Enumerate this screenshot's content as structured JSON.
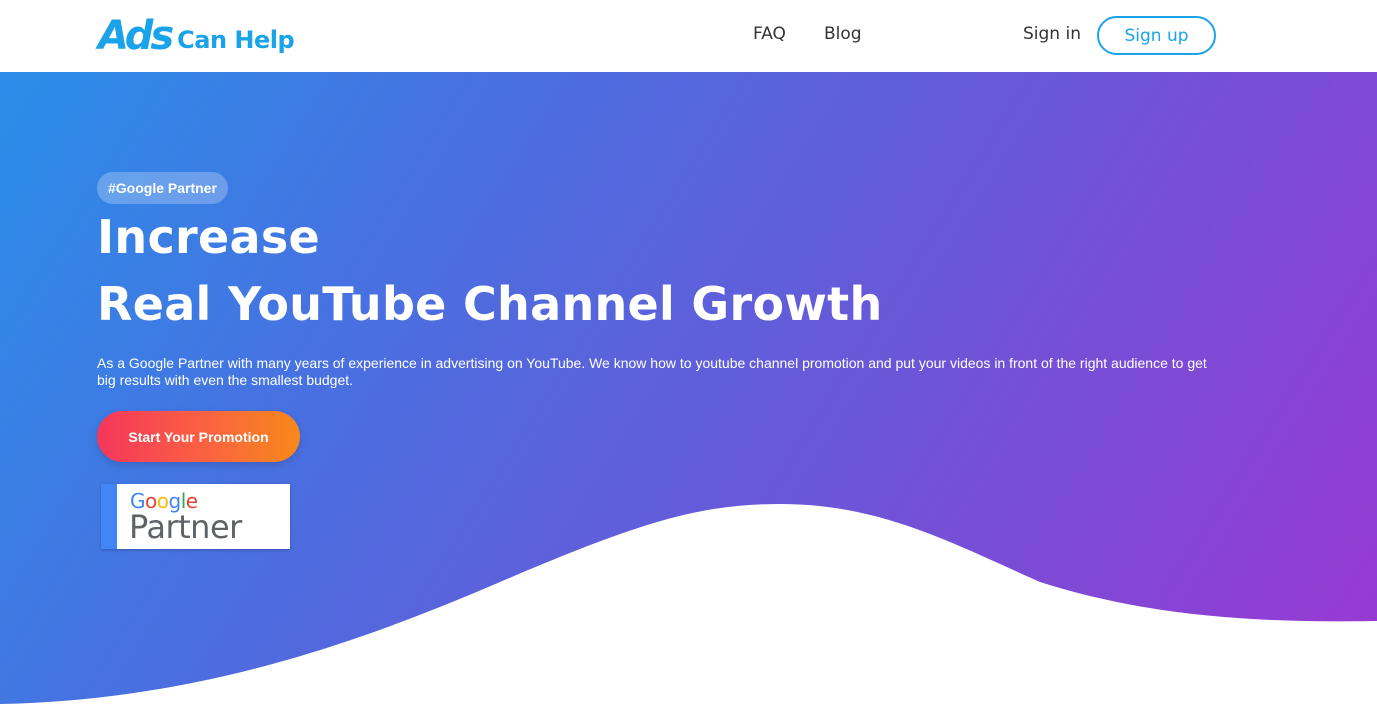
{
  "header": {
    "logo": {
      "ads": "Ads",
      "rest": "Can Help",
      "color": "#1aa3e8"
    },
    "nav": [
      {
        "label": "FAQ"
      },
      {
        "label": "Blog"
      }
    ],
    "sign_in": "Sign in",
    "sign_up": "Sign up"
  },
  "hero": {
    "badge": "#Google Partner",
    "title_line1": "Increase",
    "title_line2": "Real YouTube Channel Growth",
    "description": "As a Google Partner with many years of experience in advertising on YouTube. We know how to youtube channel promotion and put your videos in front of the right audience to get big results with even the smallest budget.",
    "cta": "Start Your Promotion",
    "partner_badge": {
      "google": "Google",
      "partner": "Partner"
    },
    "gradient": [
      "#2a8ee9",
      "#6a57d8",
      "#9a38d2"
    ],
    "cta_gradient": [
      "#f5365c",
      "#f7891b"
    ]
  }
}
